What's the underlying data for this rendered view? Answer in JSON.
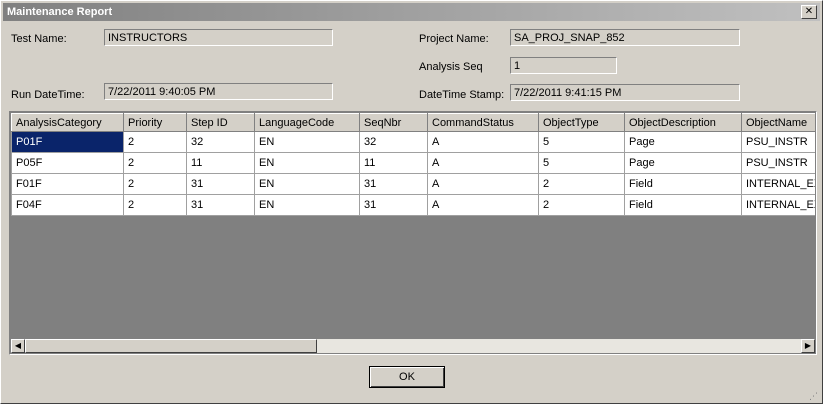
{
  "window": {
    "title": "Maintenance Report",
    "close_glyph": "✕"
  },
  "form": {
    "test_name_label": "Test Name:",
    "test_name_value": "INSTRUCTORS",
    "project_name_label": "Project Name:",
    "project_name_value": "SA_PROJ_SNAP_852",
    "analysis_seq_label": "Analysis Seq",
    "analysis_seq_value": "1",
    "run_datetime_label": "Run DateTime:",
    "run_datetime_value": "7/22/2011 9:40:05 PM",
    "datetime_stamp_label": "DateTime Stamp:",
    "datetime_stamp_value": "7/22/2011 9:41:15 PM"
  },
  "grid": {
    "columns": [
      "AnalysisCategory",
      "Priority",
      "Step ID",
      "LanguageCode",
      "SeqNbr",
      "CommandStatus",
      "ObjectType",
      "ObjectDescription",
      "ObjectName"
    ],
    "rows": [
      [
        "P01F",
        "2",
        "32",
        "EN",
        "32",
        "A",
        "5",
        "Page",
        "PSU_INSTR"
      ],
      [
        "P05F",
        "2",
        "11",
        "EN",
        "11",
        "A",
        "5",
        "Page",
        "PSU_INSTR"
      ],
      [
        "F01F",
        "2",
        "31",
        "EN",
        "31",
        "A",
        "2",
        "Field",
        "INTERNAL_EXT"
      ],
      [
        "F04F",
        "2",
        "31",
        "EN",
        "31",
        "A",
        "2",
        "Field",
        "INTERNAL_EXT"
      ]
    ],
    "scroll_left_glyph": "◀",
    "scroll_right_glyph": "▶"
  },
  "buttons": {
    "ok_label": "OK"
  },
  "colors": {
    "titlebar_gradient_start": "#808080",
    "selection": "#0a246a",
    "dialog_bg": "#d4d0c8",
    "grid_empty_bg": "#808080"
  },
  "icons": {
    "close": "close-icon",
    "scroll_left": "scroll-left-arrow-icon",
    "scroll_right": "scroll-right-arrow-icon",
    "grip": "resize-grip-icon"
  }
}
